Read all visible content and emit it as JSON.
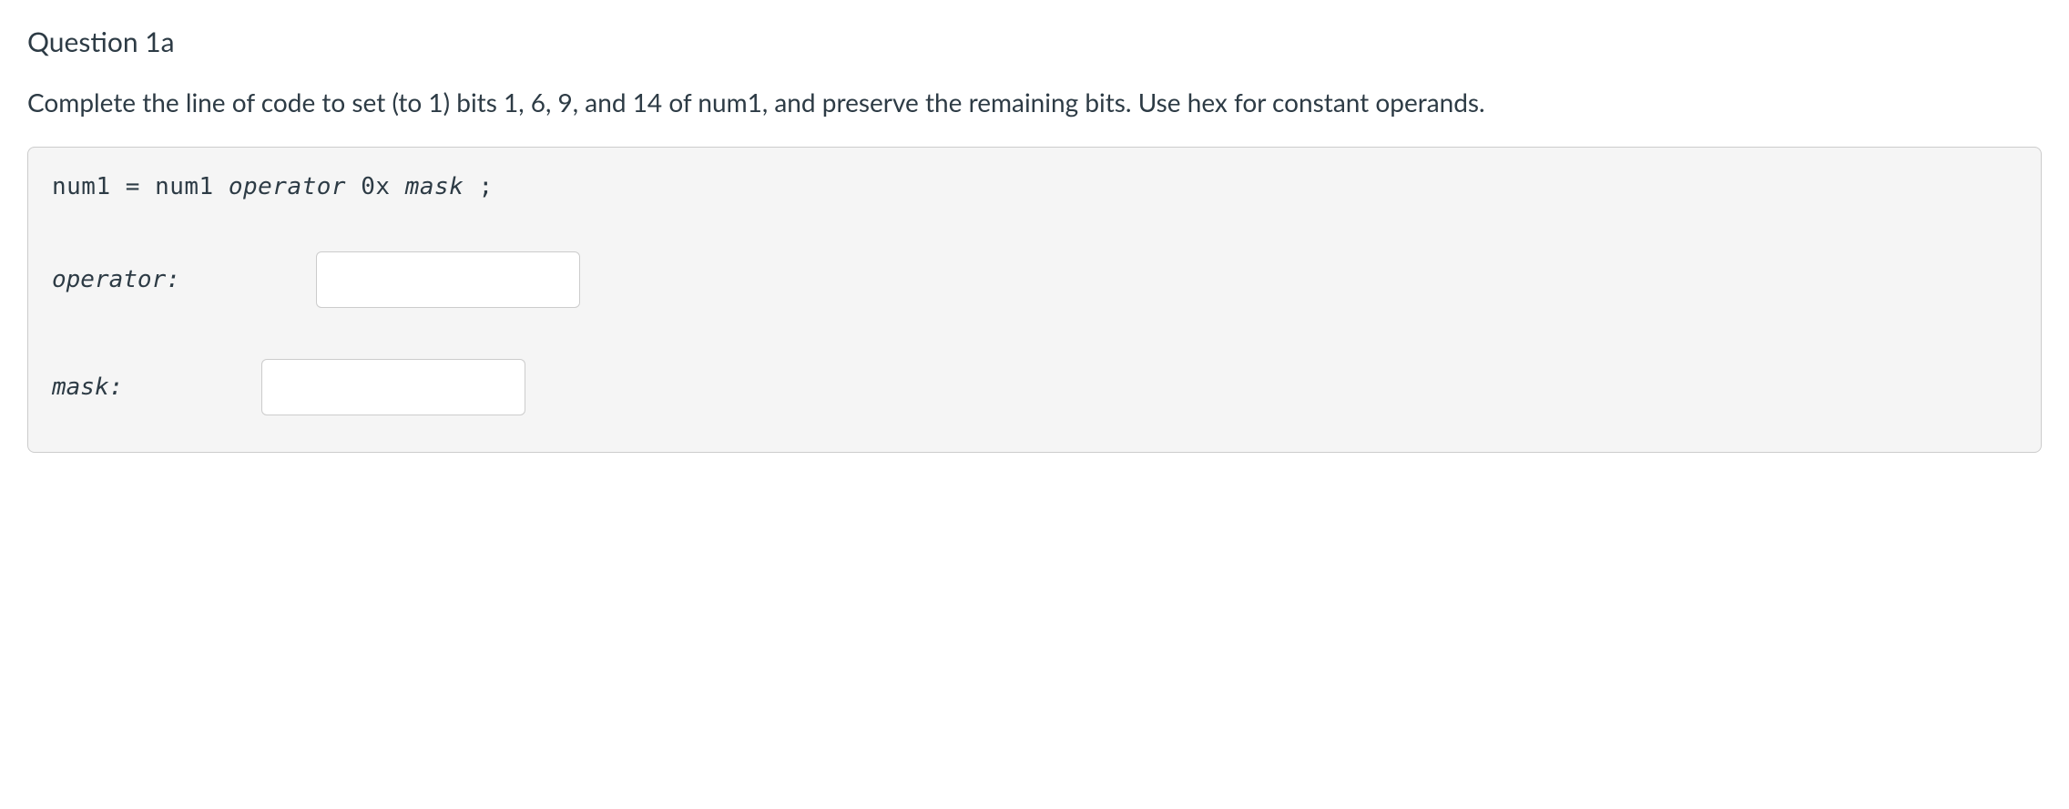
{
  "question": {
    "title": "Question 1a",
    "prompt": "Complete the line of code to set (to 1) bits 1, 6, 9, and 14 of num1, and preserve the remaining bits. Use hex for constant operands."
  },
  "code": {
    "prefix": "num1 = num1 ",
    "operator_placeholder": "operator",
    "middle": " 0x ",
    "mask_placeholder": "mask",
    "suffix": " ;"
  },
  "inputs": {
    "operator": {
      "label": "operator:",
      "value": ""
    },
    "mask": {
      "label": "mask:",
      "value": ""
    }
  }
}
